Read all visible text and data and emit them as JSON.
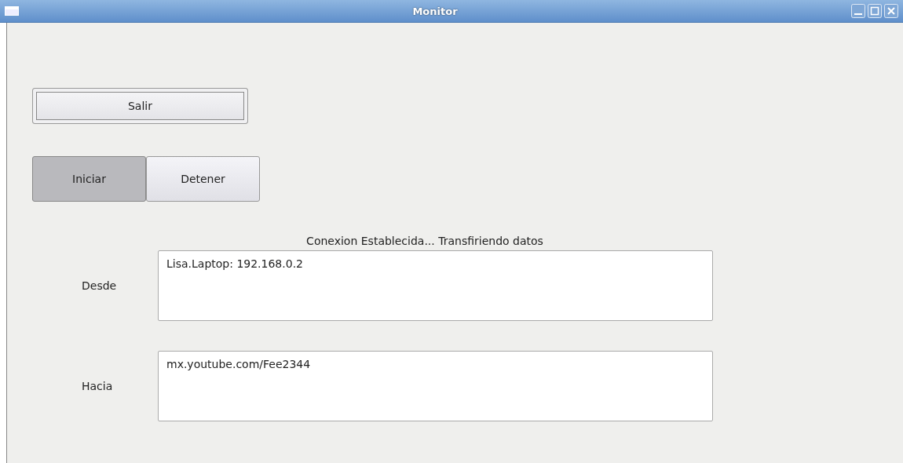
{
  "window": {
    "title": "Monitor"
  },
  "exit_button": {
    "label": "Salir"
  },
  "toggles": [
    {
      "label": "Iniciar",
      "selected": true
    },
    {
      "label": "Detener",
      "selected": false
    }
  ],
  "status": "Conexion Establecida... Transfiriendo datos",
  "fields": [
    {
      "label": "Desde",
      "value": "Lisa.Laptop: 192.168.0.2"
    },
    {
      "label": "Hacia",
      "value": "mx.youtube.com/Fee2344"
    }
  ]
}
